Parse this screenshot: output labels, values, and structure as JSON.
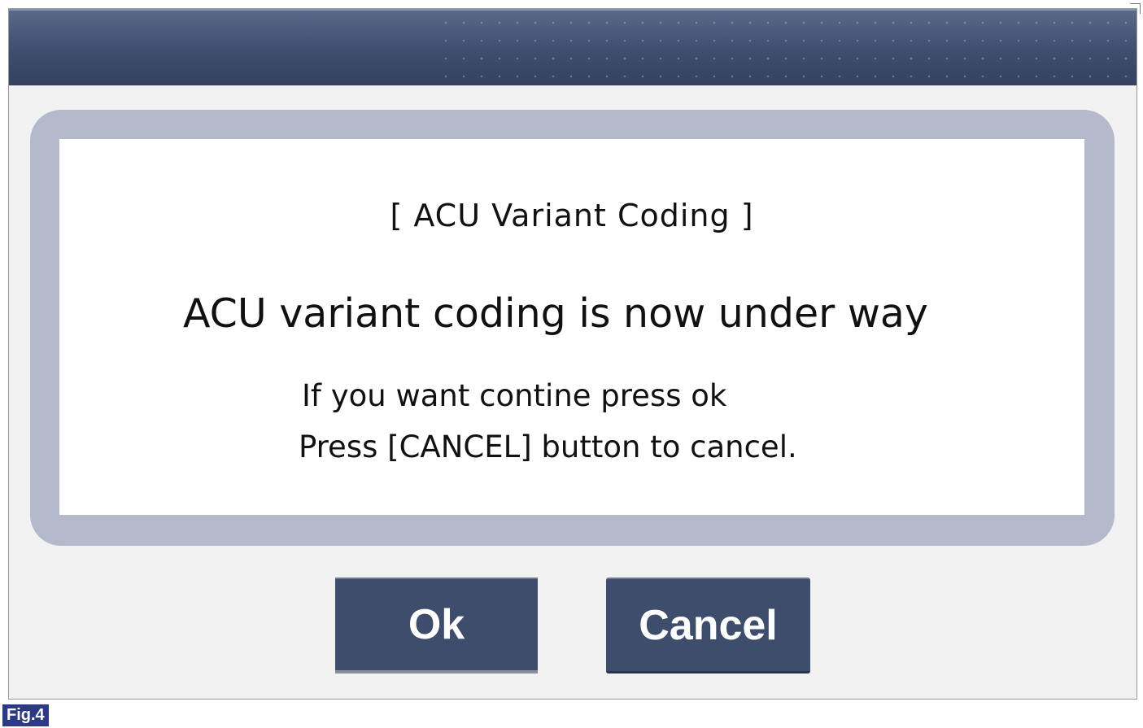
{
  "dialog": {
    "heading": "[ ACU Variant Coding ]",
    "message": "ACU variant coding is now under way",
    "instruction_line1": "If you want contine press ok",
    "instruction_line2": "Press [CANCEL] button to cancel."
  },
  "buttons": {
    "ok_label": "Ok",
    "cancel_label": "Cancel"
  },
  "figure_label": "Fig.4",
  "colors": {
    "title_bar": "#3f4e6e",
    "panel_border": "#b4b9cb",
    "button": "#3e4d6c",
    "figure_label_bg": "#2b3a82"
  }
}
